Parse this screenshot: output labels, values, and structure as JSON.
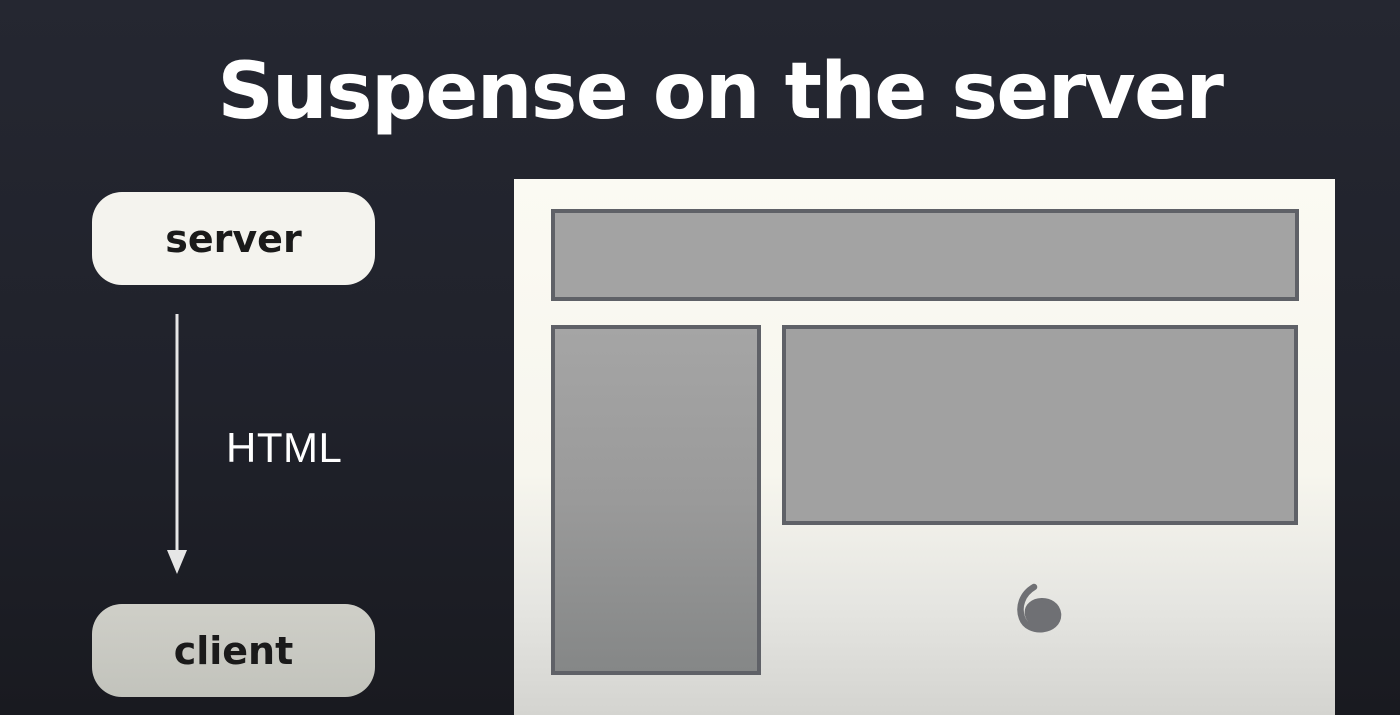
{
  "title": "Suspense on the server",
  "flow": {
    "source": "server",
    "edge_label": "HTML",
    "target": "client"
  },
  "page_mock": {
    "blocks": [
      "header",
      "sidebar",
      "content"
    ],
    "pending_indicator": "spinner-icon"
  }
}
